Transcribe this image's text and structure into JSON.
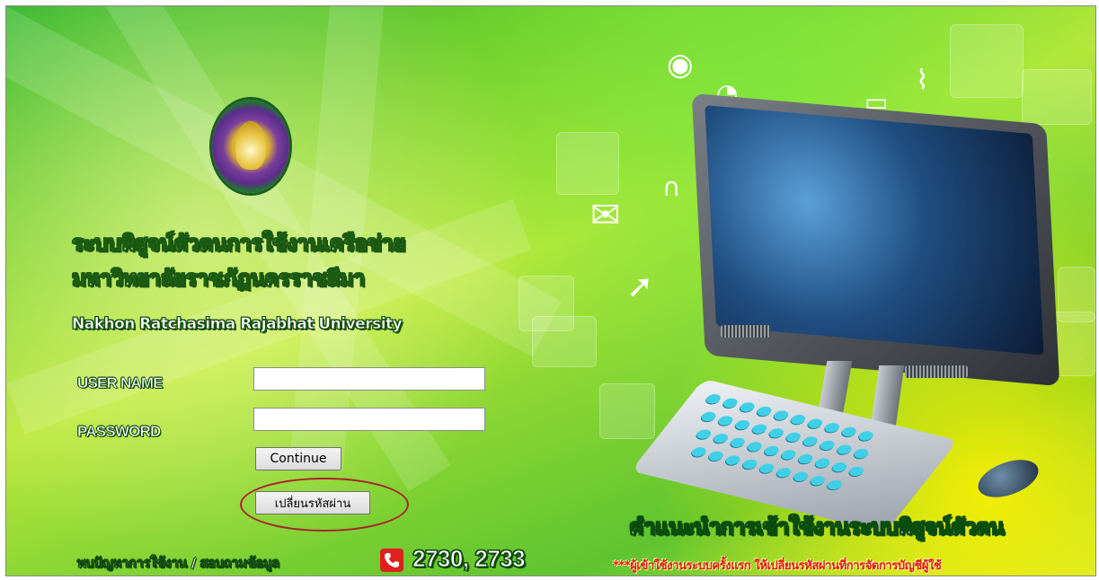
{
  "branding": {
    "title_line1": "ระบบพิสูจน์ตัวตนการใช้งานเครือข่าย",
    "title_line2": "มหาวิทยาลัยราชภัฏนครราชสีมา",
    "university_en": "Nakhon Ratchasima Rajabhat University",
    "logo_icon": "university-seal-icon"
  },
  "login_form": {
    "username_label": "USER NAME",
    "password_label": "PASSWORD",
    "username_value": "",
    "password_value": "",
    "continue_label": "Continue",
    "change_password_label": "เปลี่ยนรหัสผ่าน"
  },
  "contact": {
    "label": "พบปัญหาการใช้งาน / สอบถามข้อมูล",
    "phone_icon": "phone-icon",
    "phone_numbers": "2730, 2733"
  },
  "guide": {
    "heading": "คำแนะนำการเข้าใช้งานระบบพิสูจน์ตัวตน",
    "note": "***ผู้เข้าใช้งานระบบครั้งแรก ให้เปลี่ยนรหัสผ่านที่การจัดการบัญชีผู้ใช้"
  },
  "colors": {
    "background_green": "#7ad12c",
    "highlight_yellow": "#fff000",
    "title_outline": "#1a5d12",
    "note_red": "#e01818",
    "phone_red": "#e0201e",
    "annotation_oval": "#a8222a"
  }
}
